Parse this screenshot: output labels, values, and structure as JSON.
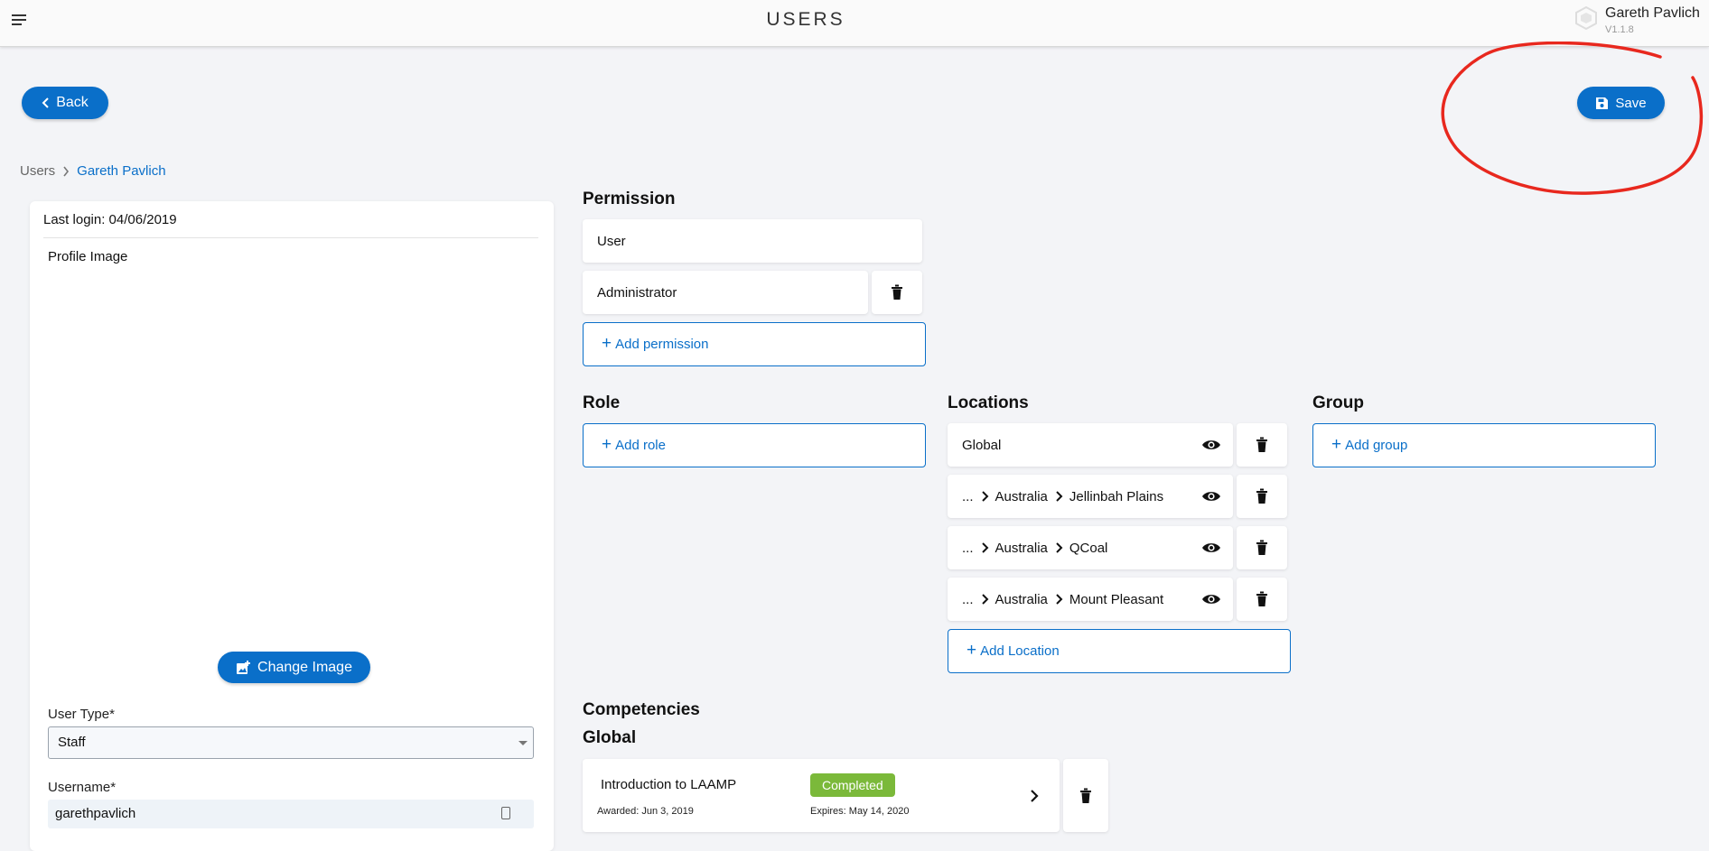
{
  "header": {
    "title": "USERS",
    "user_name": "Gareth Pavlich",
    "version": "V1.1.8"
  },
  "toolbar": {
    "back_label": "Back",
    "save_label": "Save"
  },
  "breadcrumb": {
    "root": "Users",
    "current": "Gareth Pavlich"
  },
  "profile": {
    "last_login": "Last login: 04/06/2019",
    "profile_image_label": "Profile Image",
    "change_image_label": "Change Image",
    "user_type_label": "User Type*",
    "user_type_value": "Staff",
    "username_label": "Username*",
    "username_value": "garethpavlich"
  },
  "permission": {
    "title": "Permission",
    "items": [
      {
        "label": "User"
      },
      {
        "label": "Administrator"
      }
    ],
    "add_label": "Add permission"
  },
  "role": {
    "title": "Role",
    "add_label": "Add role"
  },
  "locations": {
    "title": "Locations",
    "items": [
      {
        "path": [
          "Global"
        ]
      },
      {
        "path": [
          "...",
          "Australia",
          "Jellinbah Plains"
        ]
      },
      {
        "path": [
          "...",
          "Australia",
          "QCoal"
        ]
      },
      {
        "path": [
          "...",
          "Australia",
          "Mount Pleasant"
        ]
      }
    ],
    "add_label": "Add Location"
  },
  "group": {
    "title": "Group",
    "add_label": "Add group"
  },
  "competencies": {
    "title": "Competencies",
    "subtitle": "Global",
    "items": [
      {
        "name": "Introduction to LAAMP",
        "status": "Completed",
        "awarded": "Awarded: Jun 3, 2019",
        "expires": "Expires: May 14, 2020"
      }
    ]
  },
  "colors": {
    "accent": "#0a6fc9",
    "background": "#f3f4f7",
    "status_completed": "#7bb93a",
    "annotation": "#e8281e"
  },
  "icons": [
    "menu-icon",
    "chevron-left-icon",
    "save-icon",
    "add-photo-icon",
    "trash-icon",
    "eye-icon",
    "chevron-right-icon",
    "contact-card-icon"
  ]
}
